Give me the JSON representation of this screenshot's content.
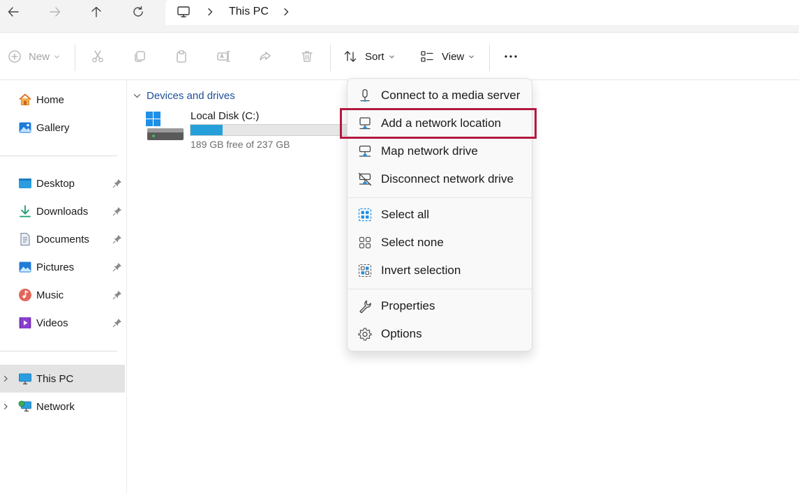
{
  "address": {
    "location": "This PC",
    "icon": "monitor-icon"
  },
  "toolbar": {
    "new_label": "New",
    "sort_label": "Sort",
    "view_label": "View"
  },
  "sidebar": {
    "items": [
      {
        "label": "Home",
        "icon": "home-icon"
      },
      {
        "label": "Gallery",
        "icon": "gallery-icon"
      },
      {
        "label": "Desktop",
        "icon": "desktop-folder-icon",
        "pinned": true
      },
      {
        "label": "Downloads",
        "icon": "downloads-icon",
        "pinned": true
      },
      {
        "label": "Documents",
        "icon": "documents-icon",
        "pinned": true
      },
      {
        "label": "Pictures",
        "icon": "pictures-icon",
        "pinned": true
      },
      {
        "label": "Music",
        "icon": "music-icon",
        "pinned": true
      },
      {
        "label": "Videos",
        "icon": "videos-icon",
        "pinned": true
      },
      {
        "label": "This PC",
        "icon": "this-pc-icon",
        "selected": true
      },
      {
        "label": "Network",
        "icon": "network-icon"
      }
    ]
  },
  "content": {
    "section_title": "Devices and drives",
    "drive": {
      "name": "Local Disk (C:)",
      "free_text": "189 GB free of 237 GB",
      "used_fraction": 0.2
    }
  },
  "menu": {
    "items": [
      {
        "label": "Connect to a media server",
        "icon": "media-server-icon"
      },
      {
        "label": "Add a network location",
        "icon": "network-location-icon",
        "highlighted": true
      },
      {
        "label": "Map network drive",
        "icon": "map-drive-icon"
      },
      {
        "label": "Disconnect network drive",
        "icon": "disconnect-drive-icon"
      },
      {
        "label": "Select all",
        "icon": "select-all-icon"
      },
      {
        "label": "Select none",
        "icon": "select-none-icon"
      },
      {
        "label": "Invert selection",
        "icon": "invert-selection-icon"
      },
      {
        "label": "Properties",
        "icon": "wrench-icon"
      },
      {
        "label": "Options",
        "icon": "gear-icon"
      }
    ]
  },
  "colors": {
    "accent": "#26a0da",
    "highlight": "#b3193f",
    "section_header": "#1e4f99"
  }
}
